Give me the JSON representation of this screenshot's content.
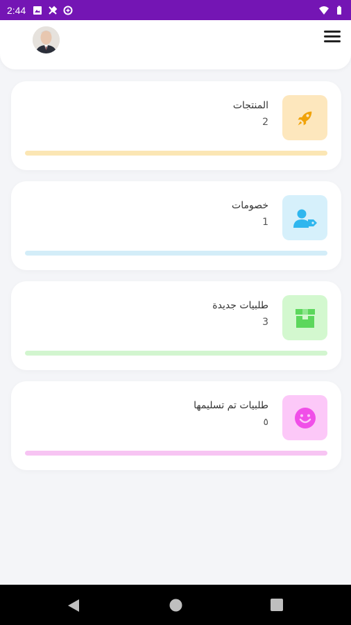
{
  "status_bar": {
    "time": "2:44"
  },
  "header": {
    "avatar_icon": "user-avatar",
    "menu_icon": "hamburger-menu-icon"
  },
  "cards": [
    {
      "title": "المنتجات",
      "count": "2",
      "icon": "rocket-icon",
      "icon_bg": "#fde7bd",
      "icon_color": "#f0a30a",
      "bar_color": "#fbe6b4"
    },
    {
      "title": "خصومات",
      "count": "1",
      "icon": "user-tag-icon",
      "icon_bg": "#d6f0fb",
      "icon_color": "#2fb6ee",
      "bar_color": "#d3edf8"
    },
    {
      "title": "طلبيات جديدة",
      "count": "3",
      "icon": "box-icon",
      "icon_bg": "#d3f8cf",
      "icon_color": "#5cd75c",
      "bar_color": "#d2f5cf"
    },
    {
      "title": "طلبيات تم تسليمها",
      "count": "٥",
      "icon": "smile-icon",
      "icon_bg": "#fcc8f8",
      "icon_color": "#f04fe8",
      "bar_color": "#f7c4f3"
    }
  ],
  "nav": {
    "back_icon": "back-triangle-icon",
    "home_icon": "home-circle-icon",
    "recents_icon": "recents-square-icon"
  }
}
